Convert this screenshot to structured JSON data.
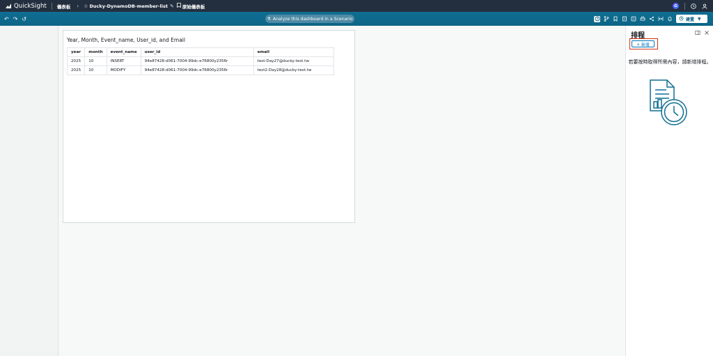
{
  "topbar": {
    "brand": "QuickSight",
    "crumb_dashboards": "儀表板",
    "dashboard_name": "Ducky-DynamoDB-member-list",
    "original_dashboard": "原始儀表板"
  },
  "toolbar": {
    "scenario_label": "Analyze this dashboard in a Scenario",
    "settings_label": "建置"
  },
  "visual": {
    "title": "Year, Month, Event_name, User_id, and Email",
    "columns": [
      "year",
      "month",
      "event_name",
      "user_id",
      "email"
    ],
    "rows": [
      [
        "2025",
        "10",
        "INSERT",
        "94e87428-d061-7004-99dc-e76800y2356r",
        "test-Day27@ducky-test.tw"
      ],
      [
        "2025",
        "10",
        "MODIFY",
        "94e87428-d061-7004-99dc-e76800y2356r",
        "test2-Day28@ducky-test.tw"
      ]
    ]
  },
  "panel": {
    "title": "排程",
    "add_label": "+ 新增",
    "message": "若要按時取得所需內容，請新增排程。"
  },
  "colors": {
    "topbar_bg": "#232f3e",
    "toolbar_bg": "#0d6586",
    "highlight": "#d13212",
    "accent": "#0073bb"
  }
}
